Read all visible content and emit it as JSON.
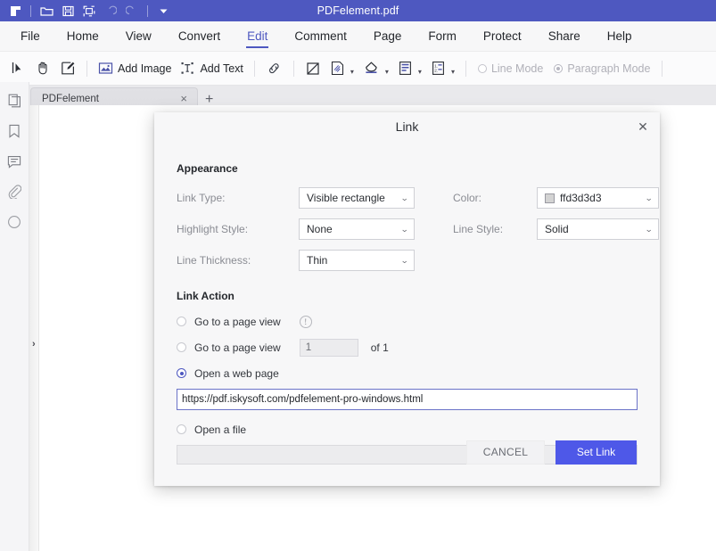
{
  "titlebar": {
    "document_title": "PDFelement.pdf",
    "icons": [
      "app-logo-icon",
      "open-folder-icon",
      "save-icon",
      "print-icon",
      "undo-icon",
      "redo-icon",
      "customize-dropdown-icon"
    ]
  },
  "menubar": {
    "items": [
      {
        "label": "File",
        "active": false
      },
      {
        "label": "Home",
        "active": false
      },
      {
        "label": "View",
        "active": false
      },
      {
        "label": "Convert",
        "active": false
      },
      {
        "label": "Edit",
        "active": true
      },
      {
        "label": "Comment",
        "active": false
      },
      {
        "label": "Page",
        "active": false
      },
      {
        "label": "Form",
        "active": false
      },
      {
        "label": "Protect",
        "active": false
      },
      {
        "label": "Share",
        "active": false
      },
      {
        "label": "Help",
        "active": false
      }
    ]
  },
  "toolbar": {
    "select_tool": "select-tool-icon",
    "hand_tool": "hand-tool-icon",
    "edit_tool": "edit-text-tool-icon",
    "add_image_label": "Add Image",
    "add_text_label": "Add Text",
    "link_tool": "link-icon",
    "crop_tool": "crop-icon",
    "watermark_tool": "watermark-icon",
    "background_tool": "background-icon",
    "header_footer_tool": "header-footer-icon",
    "bates_numbering_tool": "bates-numbering-icon",
    "line_mode_label": "Line Mode",
    "paragraph_mode_label": "Paragraph Mode",
    "line_mode_selected": false,
    "paragraph_mode_selected": true
  },
  "tabstrip": {
    "home_icon": "home-icon",
    "tabs": [
      {
        "label": "PDFelement",
        "close": "×"
      }
    ],
    "new_tab": "+"
  },
  "rail": {
    "items": [
      "thumbnails-icon",
      "bookmark-icon",
      "annotation-icon",
      "attachment-icon",
      "stamp-icon"
    ],
    "expander": "›"
  },
  "dialog": {
    "title": "Link",
    "close": "✕",
    "appearance": {
      "section_label": "Appearance",
      "fields": [
        {
          "label": "Link Type:",
          "value": "Visible rectangle"
        },
        {
          "label": "Highlight Style:",
          "value": "None"
        },
        {
          "label": "Line Thickness:",
          "value": "Thin"
        }
      ],
      "right_fields": [
        {
          "label": "Color:",
          "value": "ffd3d3d3",
          "swatch": "#d3d3d3"
        },
        {
          "label": "Line Style:",
          "value": "Solid"
        }
      ]
    },
    "link_action": {
      "section_label": "Link Action",
      "option_page_view_a": {
        "label": "Go to a page view",
        "selected": false,
        "info_icon": "!"
      },
      "option_page_view_b": {
        "label": "Go to a page view",
        "selected": false,
        "page_value": "1",
        "of_label": "of 1"
      },
      "option_web_page": {
        "label": "Open a web page",
        "selected": true
      },
      "url_value": "https://pdf.iskysoft.com/pdfelement-pro-windows.html",
      "option_open_file": {
        "label": "Open a file",
        "selected": false
      },
      "file_value": "",
      "file_browse_label": "..."
    },
    "buttons": {
      "cancel": "CANCEL",
      "set_link": "Set Link"
    }
  },
  "colors": {
    "titlebar": "#4e58c0",
    "accent": "#4e58c0",
    "primary_button": "#4e58e8",
    "color_swatch": "#d3d3d3"
  }
}
